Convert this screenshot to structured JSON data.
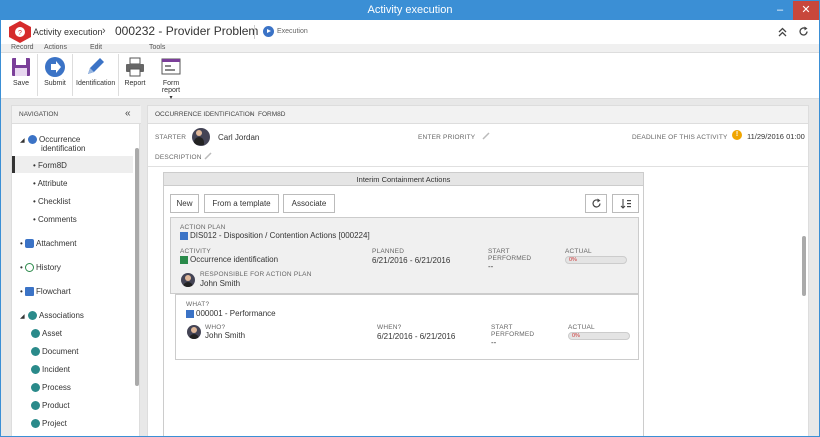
{
  "window": {
    "title": "Activity execution",
    "minimize": "–",
    "close": "✕"
  },
  "header": {
    "app": "Activity execution",
    "sep": "›",
    "title": "000232 - Provider Problem",
    "mode": "Execution"
  },
  "ribbon": {
    "groups": [
      "Record",
      "Actions",
      "Edit",
      "Tools"
    ],
    "buttons": {
      "save": "Save",
      "submit": "Submit",
      "identification": "Identification",
      "report": "Report",
      "form_report": "Form report",
      "form_report_arrow": "▾"
    }
  },
  "nav": {
    "title": "NAVIGATION",
    "collapse": "«",
    "items": [
      {
        "label": "Occurrence",
        "label2": "identification"
      },
      {
        "label": "Form8D"
      },
      {
        "label": "Attribute"
      },
      {
        "label": "Checklist"
      },
      {
        "label": "Comments"
      },
      {
        "label": "Attachment"
      },
      {
        "label": "History"
      },
      {
        "label": "Flowchart"
      },
      {
        "label": "Associations"
      },
      {
        "label": "Asset"
      },
      {
        "label": "Document"
      },
      {
        "label": "Incident"
      },
      {
        "label": "Process"
      },
      {
        "label": "Product"
      },
      {
        "label": "Project"
      }
    ]
  },
  "breadcrumb": {
    "part1": "OCCURRENCE IDENTIFICATION",
    "sep": "›",
    "part2": "FORM8D"
  },
  "fields": {
    "starter_label": "STARTER",
    "starter": "Carl Jordan",
    "priority_label": "ENTER PRIORITY",
    "deadline_label": "DEADLINE OF THIS ACTIVITY",
    "deadline": "11/29/2016  01:00",
    "description_label": "DESCRIPTION"
  },
  "panel": {
    "title": "Interim Containment Actions",
    "buttons": {
      "new": "New",
      "template": "From a template",
      "associate": "Associate"
    },
    "plan": {
      "plan_label": "ACTION PLAN",
      "plan": "DIS012 - Disposition / Contention Actions [000224]",
      "activity_label": "ACTIVITY",
      "activity": "Occurrence identification",
      "planned_label": "PLANNED",
      "planned": "6/21/2016 - 6/21/2016",
      "start_label": "START",
      "performed_label": "PERFORMED",
      "performed": "--",
      "actual_label": "ACTUAL",
      "actual": "0%",
      "resp_label": "RESPONSIBLE FOR ACTION PLAN",
      "resp": "John Smith"
    },
    "action": {
      "what_label": "WHAT?",
      "what": "000001 - Performance",
      "who_label": "WHO?",
      "who": "John Smith",
      "when_label": "WHEN?",
      "when": "6/21/2016 - 6/21/2016",
      "start_label": "START",
      "performed_label": "PERFORMED",
      "performed": "--",
      "actual_label": "ACTUAL",
      "actual": "0%"
    }
  },
  "progress": {
    "plan_actual": 0,
    "action_actual": 0
  },
  "colors": {
    "titlebar": "#3b8fd5",
    "brand": "#d62b2b",
    "accent": "#3b73c6"
  }
}
